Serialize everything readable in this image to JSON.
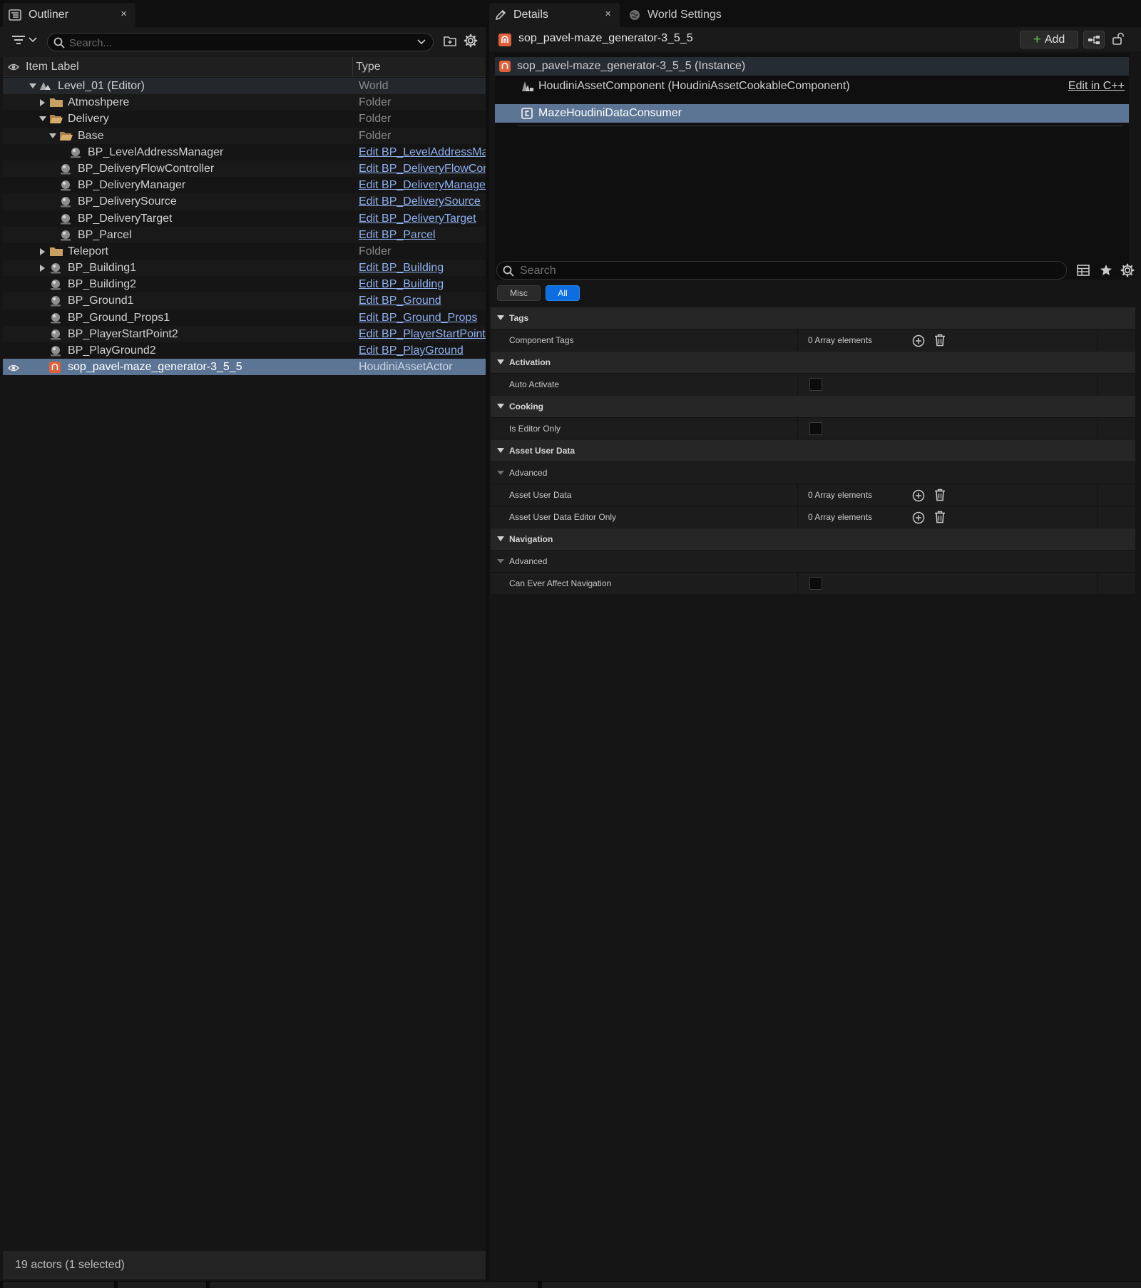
{
  "outliner": {
    "tab_title": "Outliner",
    "tab_close": "×",
    "search_placeholder": "Search...",
    "columns": {
      "label": "Item Label",
      "type": "Type"
    },
    "rows": [
      {
        "label": "Level_01 (Editor)",
        "type": "World",
        "icon": "world-icon",
        "expander": "expanded"
      },
      {
        "label": "Atmoshpere",
        "type": "Folder",
        "icon": "folder-icon",
        "expander": "collapsed"
      },
      {
        "label": "Delivery",
        "type": "Folder",
        "icon": "folder-open-icon",
        "expander": "expanded"
      },
      {
        "label": "Base",
        "type": "Folder",
        "icon": "folder-open-icon",
        "expander": "expanded"
      },
      {
        "label": "BP_LevelAddressManager",
        "type": "Edit BP_LevelAddressManager",
        "icon": "actor-icon"
      },
      {
        "label": "BP_DeliveryFlowController",
        "type": "Edit BP_DeliveryFlowController",
        "icon": "actor-icon"
      },
      {
        "label": "BP_DeliveryManager",
        "type": "Edit BP_DeliveryManager",
        "icon": "actor-icon"
      },
      {
        "label": "BP_DeliverySource",
        "type": "Edit BP_DeliverySource",
        "icon": "actor-icon"
      },
      {
        "label": "BP_DeliveryTarget",
        "type": "Edit BP_DeliveryTarget",
        "icon": "actor-icon"
      },
      {
        "label": "BP_Parcel",
        "type": "Edit BP_Parcel",
        "icon": "actor-icon"
      },
      {
        "label": "Teleport",
        "type": "Folder",
        "icon": "folder-icon",
        "expander": "collapsed"
      },
      {
        "label": "BP_Building1",
        "type": "Edit BP_Building",
        "icon": "actor-icon",
        "expander": "collapsed"
      },
      {
        "label": "BP_Building2",
        "type": "Edit BP_Building",
        "icon": "actor-icon"
      },
      {
        "label": "BP_Ground1",
        "type": "Edit BP_Ground",
        "icon": "actor-icon"
      },
      {
        "label": "BP_Ground_Props1",
        "type": "Edit BP_Ground_Props",
        "icon": "actor-icon"
      },
      {
        "label": "BP_PlayerStartPoint2",
        "type": "Edit BP_PlayerStartPoint",
        "icon": "actor-icon"
      },
      {
        "label": "BP_PlayGround2",
        "type": "Edit BP_PlayGround",
        "icon": "actor-icon"
      },
      {
        "label": "sop_pavel-maze_generator-3_5_5",
        "type": "HoudiniAssetActor",
        "icon": "houdini-icon",
        "selected": true
      }
    ],
    "footer": "19 actors (1 selected)"
  },
  "details": {
    "tab_title": "Details",
    "tab_close": "×",
    "world_settings_tab": "World Settings",
    "actor_name": "sop_pavel-maze_generator-3_5_5",
    "add_label": "Add",
    "components": {
      "instance": "sop_pavel-maze_generator-3_5_5 (Instance)",
      "houdini_component": "HoudiniAssetComponent (HoudiniAssetCookableComponent)",
      "edit_cpp": "Edit in C++",
      "consumer": "MazeHoudiniDataConsumer"
    },
    "search_placeholder": "Search",
    "filters": {
      "misc": "Misc",
      "all": "All"
    },
    "properties": [
      {
        "kind": "category",
        "label": "Tags"
      },
      {
        "kind": "row",
        "label": "Component Tags",
        "value": "0 Array elements",
        "widget": "array"
      },
      {
        "kind": "category",
        "label": "Activation"
      },
      {
        "kind": "row",
        "label": "Auto Activate",
        "widget": "checkbox",
        "checked": false
      },
      {
        "kind": "category",
        "label": "Cooking"
      },
      {
        "kind": "row",
        "label": "Is Editor Only",
        "widget": "checkbox",
        "checked": false
      },
      {
        "kind": "category",
        "label": "Asset User Data"
      },
      {
        "kind": "advanced",
        "label": "Advanced"
      },
      {
        "kind": "row",
        "label": "Asset User Data",
        "value": "0 Array elements",
        "widget": "array"
      },
      {
        "kind": "row",
        "label": "Asset User Data Editor Only",
        "value": "0 Array elements",
        "widget": "array"
      },
      {
        "kind": "category",
        "label": "Navigation"
      },
      {
        "kind": "advanced",
        "label": "Advanced"
      },
      {
        "kind": "row",
        "label": "Can Ever Affect Navigation",
        "widget": "checkbox",
        "checked": false
      }
    ]
  },
  "colors": {
    "selection": "#5d7594",
    "link": "#8fb0ee",
    "accent_blue": "#0c6ee0",
    "folder": "#c9a063",
    "houdini": "#e0603a",
    "add_plus": "#5fbf4a"
  }
}
